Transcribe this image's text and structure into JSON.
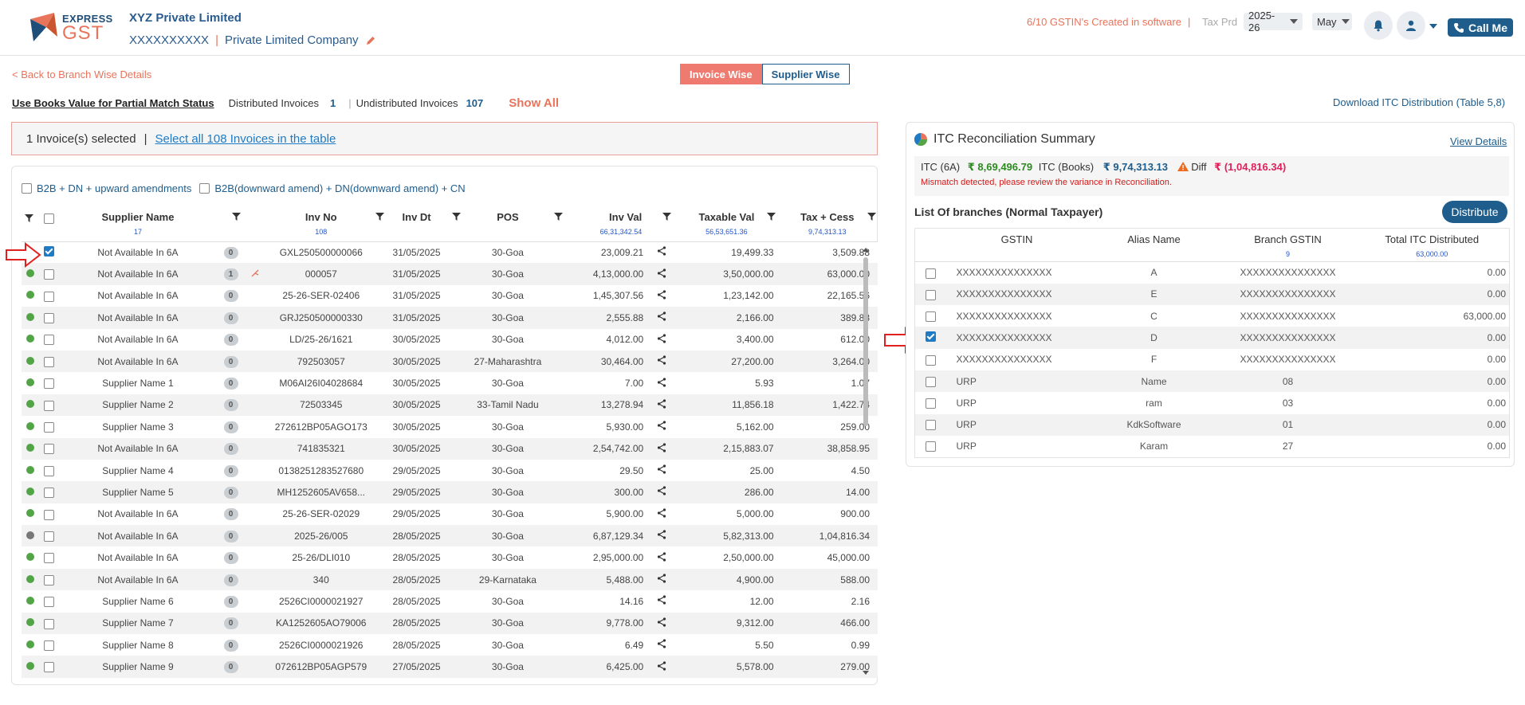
{
  "header": {
    "logo_top": "EXPRESS",
    "logo_bottom": "GST",
    "company_name": "XYZ Private Limited",
    "gstin": "XXXXXXXXXX",
    "company_type": "Private Limited Company",
    "gstin_message": "6/10 GSTIN's Created in software",
    "tax_period_label": "Tax Prd",
    "year": "2025-26",
    "month": "May",
    "call_label": "Call Me",
    "colors": {
      "brand_blue": "#1f5d8c",
      "accent_orange": "#e8745c"
    }
  },
  "nav": {
    "back_label": "< Back to Branch Wise Details",
    "view_toggle": {
      "invoice_wise": "Invoice Wise",
      "supplier_wise": "Supplier Wise",
      "active": "Invoice Wise"
    }
  },
  "summary_line": {
    "books_value_label": "Use Books Value for Partial Match Status",
    "distributed_label": "Distributed Invoices",
    "distributed_count": "1",
    "undistributed_label": "Undistributed Invoices",
    "undistributed_count": "107",
    "show_all": "Show All",
    "download_label": "Download ITC Distribution (Table 5,8)"
  },
  "selection": {
    "selected_text": "1 Invoice(s) selected",
    "select_all_link": "Select all 108 Invoices in the table"
  },
  "filters": {
    "b2b_label": "B2B + DN + upward amendments",
    "b2b_down_label": "B2B(downward amend) + DN(downward amend) + CN"
  },
  "invoice_table": {
    "headers": {
      "supplier": "Supplier Name",
      "supplier_total": "17",
      "inv_no": "Inv No",
      "inv_no_total": "108",
      "inv_dt": "Inv Dt",
      "pos": "POS",
      "inv_val": "Inv Val",
      "inv_val_total": "66,31,342.54",
      "taxable": "Taxable Val",
      "taxable_total": "56,53,651.36",
      "tax": "Tax + Cess",
      "tax_total": "9,74,313.13"
    },
    "rows": [
      {
        "status": "green",
        "checked": true,
        "supplier": "Not Available In 6A",
        "count": "0",
        "inv_no": "GXL250500000066",
        "inv_dt": "31/05/2025",
        "pos": "30-Goa",
        "inv_val": "23,009.21",
        "taxable": "19,499.33",
        "tax": "3,509.88"
      },
      {
        "status": "green",
        "checked": false,
        "supplier": "Not Available In 6A",
        "count": "1",
        "split": true,
        "inv_no": "000057",
        "inv_dt": "31/05/2025",
        "pos": "30-Goa",
        "inv_val": "4,13,000.00",
        "taxable": "3,50,000.00",
        "tax": "63,000.00"
      },
      {
        "status": "green",
        "checked": false,
        "supplier": "Not Available In 6A",
        "count": "0",
        "inv_no": "25-26-SER-02406",
        "inv_dt": "31/05/2025",
        "pos": "30-Goa",
        "inv_val": "1,45,307.56",
        "taxable": "1,23,142.00",
        "tax": "22,165.56"
      },
      {
        "status": "green",
        "checked": false,
        "supplier": "Not Available In 6A",
        "count": "0",
        "inv_no": "GRJ250500000330",
        "inv_dt": "31/05/2025",
        "pos": "30-Goa",
        "inv_val": "2,555.88",
        "taxable": "2,166.00",
        "tax": "389.88"
      },
      {
        "status": "green",
        "checked": false,
        "supplier": "Not Available In 6A",
        "count": "0",
        "inv_no": "LD/25-26/1621",
        "inv_dt": "30/05/2025",
        "pos": "30-Goa",
        "inv_val": "4,012.00",
        "taxable": "3,400.00",
        "tax": "612.00"
      },
      {
        "status": "green",
        "checked": false,
        "supplier": "Not Available In 6A",
        "count": "0",
        "inv_no": "792503057",
        "inv_dt": "30/05/2025",
        "pos": "27-Maharashtra",
        "inv_val": "30,464.00",
        "taxable": "27,200.00",
        "tax": "3,264.00"
      },
      {
        "status": "green",
        "checked": false,
        "supplier": "Supplier Name 1",
        "count": "0",
        "inv_no": "M06AI26I04028684",
        "inv_dt": "30/05/2025",
        "pos": "30-Goa",
        "inv_val": "7.00",
        "taxable": "5.93",
        "tax": "1.07"
      },
      {
        "status": "green",
        "checked": false,
        "supplier": "Supplier Name 2",
        "count": "0",
        "inv_no": "72503345",
        "inv_dt": "30/05/2025",
        "pos": "33-Tamil Nadu",
        "inv_val": "13,278.94",
        "taxable": "11,856.18",
        "tax": "1,422.74"
      },
      {
        "status": "green",
        "checked": false,
        "supplier": "Supplier Name 3",
        "count": "0",
        "inv_no": "272612BP05AGO173",
        "inv_dt": "30/05/2025",
        "pos": "30-Goa",
        "inv_val": "5,930.00",
        "taxable": "5,162.00",
        "tax": "259.00"
      },
      {
        "status": "green",
        "checked": false,
        "supplier": "Not Available In 6A",
        "count": "0",
        "inv_no": "741835321",
        "inv_dt": "30/05/2025",
        "pos": "30-Goa",
        "inv_val": "2,54,742.00",
        "taxable": "2,15,883.07",
        "tax": "38,858.95"
      },
      {
        "status": "green",
        "checked": false,
        "supplier": "Supplier Name 4",
        "count": "0",
        "inv_no": "0138251283527680",
        "inv_dt": "29/05/2025",
        "pos": "30-Goa",
        "inv_val": "29.50",
        "taxable": "25.00",
        "tax": "4.50"
      },
      {
        "status": "green",
        "checked": false,
        "supplier": "Supplier Name 5",
        "count": "0",
        "inv_no": "MH1252605AV658...",
        "inv_dt": "29/05/2025",
        "pos": "30-Goa",
        "inv_val": "300.00",
        "taxable": "286.00",
        "tax": "14.00"
      },
      {
        "status": "green",
        "checked": false,
        "supplier": "Not Available In 6A",
        "count": "0",
        "inv_no": "25-26-SER-02029",
        "inv_dt": "29/05/2025",
        "pos": "30-Goa",
        "inv_val": "5,900.00",
        "taxable": "5,000.00",
        "tax": "900.00"
      },
      {
        "status": "gray",
        "checked": false,
        "supplier": "Not Available In 6A",
        "count": "0",
        "inv_no": "2025-26/005",
        "inv_dt": "28/05/2025",
        "pos": "30-Goa",
        "inv_val": "6,87,129.34",
        "taxable": "5,82,313.00",
        "tax": "1,04,816.34"
      },
      {
        "status": "green",
        "checked": false,
        "supplier": "Not Available In 6A",
        "count": "0",
        "inv_no": "25-26/DLI010",
        "inv_dt": "28/05/2025",
        "pos": "30-Goa",
        "inv_val": "2,95,000.00",
        "taxable": "2,50,000.00",
        "tax": "45,000.00"
      },
      {
        "status": "green",
        "checked": false,
        "supplier": "Not Available In 6A",
        "count": "0",
        "inv_no": "340",
        "inv_dt": "28/05/2025",
        "pos": "29-Karnataka",
        "inv_val": "5,488.00",
        "taxable": "4,900.00",
        "tax": "588.00"
      },
      {
        "status": "green",
        "checked": false,
        "supplier": "Supplier Name 6",
        "count": "0",
        "inv_no": "2526CI0000021927",
        "inv_dt": "28/05/2025",
        "pos": "30-Goa",
        "inv_val": "14.16",
        "taxable": "12.00",
        "tax": "2.16"
      },
      {
        "status": "green",
        "checked": false,
        "supplier": "Supplier Name 7",
        "count": "0",
        "inv_no": "KA1252605AO79006",
        "inv_dt": "28/05/2025",
        "pos": "30-Goa",
        "inv_val": "9,778.00",
        "taxable": "9,312.00",
        "tax": "466.00"
      },
      {
        "status": "green",
        "checked": false,
        "supplier": "Supplier Name 8",
        "count": "0",
        "inv_no": "2526CI0000021926",
        "inv_dt": "28/05/2025",
        "pos": "30-Goa",
        "inv_val": "6.49",
        "taxable": "5.50",
        "tax": "0.99"
      },
      {
        "status": "green",
        "checked": false,
        "supplier": "Supplier Name 9",
        "count": "0",
        "inv_no": "072612BP05AGP579",
        "inv_dt": "27/05/2025",
        "pos": "30-Goa",
        "inv_val": "6,425.00",
        "taxable": "5,578.00",
        "tax": "279.00"
      }
    ]
  },
  "itc_summary": {
    "title": "ITC Reconciliation Summary",
    "view_details": "View Details",
    "itc_6a_label": "ITC (6A)",
    "itc_6a_value": "₹ 8,69,496.79",
    "itc_books_label": "ITC (Books)",
    "itc_books_value": "₹ 9,74,313.13",
    "diff_label": "Diff",
    "diff_value": "₹ (1,04,816.34)",
    "mismatch_msg": "Mismatch detected, please review the variance in Reconciliation.",
    "branches_title": "List Of branches (Normal Taxpayer)",
    "distribute_label": "Distribute",
    "headers": {
      "gstin": "GSTIN",
      "alias": "Alias Name",
      "branch": "Branch GSTIN",
      "branch_total": "9",
      "total": "Total ITC Distributed",
      "total_sum": "63,000.00"
    },
    "rows": [
      {
        "checked": false,
        "gstin": "XXXXXXXXXXXXXXX",
        "alias": "A",
        "branch": "XXXXXXXXXXXXXXX",
        "total": "0.00"
      },
      {
        "checked": false,
        "gstin": "XXXXXXXXXXXXXXX",
        "alias": "E",
        "branch": "XXXXXXXXXXXXXXX",
        "total": "0.00"
      },
      {
        "checked": false,
        "gstin": "XXXXXXXXXXXXXXX",
        "alias": "C",
        "branch": "XXXXXXXXXXXXXXX",
        "total": "63,000.00"
      },
      {
        "checked": true,
        "gstin": "XXXXXXXXXXXXXXX",
        "alias": "D",
        "branch": "XXXXXXXXXXXXXXX",
        "total": "0.00"
      },
      {
        "checked": false,
        "gstin": "XXXXXXXXXXXXXXX",
        "alias": "F",
        "branch": "XXXXXXXXXXXXXXX",
        "total": "0.00"
      },
      {
        "checked": false,
        "gstin": "URP",
        "alias": "Name",
        "branch": "08",
        "total": "0.00"
      },
      {
        "checked": false,
        "gstin": "URP",
        "alias": "ram",
        "branch": "03",
        "total": "0.00"
      },
      {
        "checked": false,
        "gstin": "URP",
        "alias": "KdkSoftware",
        "branch": "01",
        "total": "0.00"
      },
      {
        "checked": false,
        "gstin": "URP",
        "alias": "Karam",
        "branch": "27",
        "total": "0.00"
      }
    ]
  }
}
